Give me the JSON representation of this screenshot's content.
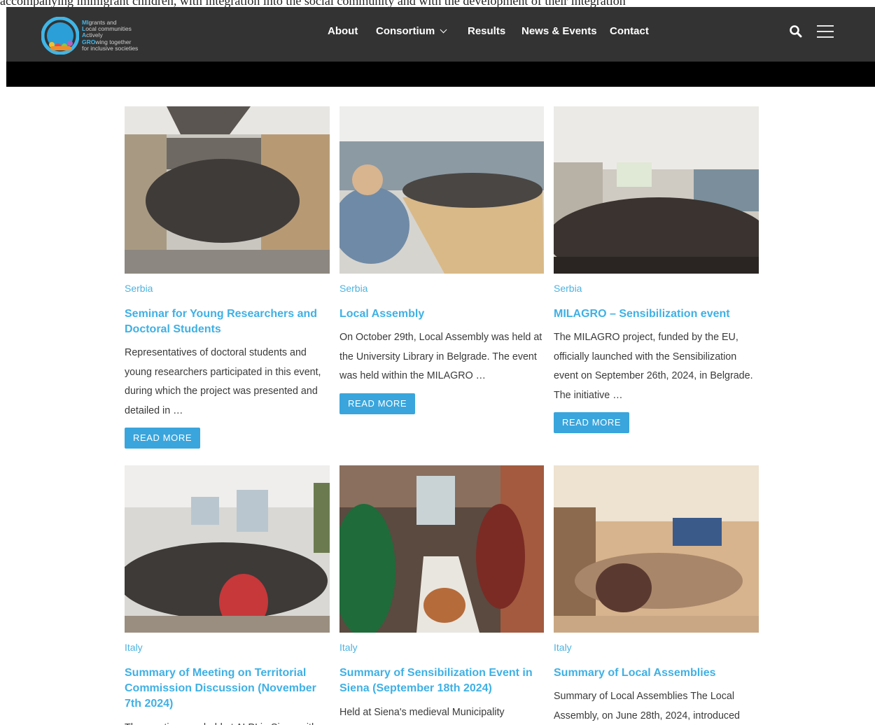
{
  "top_strip_text": "accompanying immigrant children, with integration into the social community and with the development of their integration",
  "logo": {
    "lines": [
      {
        "hl": "MI",
        "rest": "grants and"
      },
      {
        "hl": "L",
        "rest": "ocal communities"
      },
      {
        "hl": "A",
        "rest": "ctively"
      },
      {
        "hl": "GRO",
        "rest": "wing together"
      },
      {
        "hl": "",
        "rest": "for inclusive societies"
      }
    ],
    "badge": "MILAGRO"
  },
  "nav": {
    "about": "About",
    "consortium": "Consortium",
    "results": "Results",
    "news_events": "News & Events",
    "contact": "Contact"
  },
  "icons": {
    "search": "search-icon",
    "menu": "hamburger-menu-icon"
  },
  "colors": {
    "header_bg": "#333333",
    "accent": "#3fb0e4",
    "button": "#3aa5dc"
  },
  "posts": [
    {
      "category": "Serbia",
      "title": "Seminar for Young Researchers and Doctoral Students",
      "excerpt": "Representatives of doctoral students and young researchers participated in this event, during which the project was presented and detailed in …",
      "button": "READ MORE"
    },
    {
      "category": "Serbia",
      "title": "Local Assembly",
      "excerpt": "On October 29th, Local Assembly was held at the University Library in Belgrade. The event was held within the MILAGRO …",
      "button": "READ MORE"
    },
    {
      "category": "Serbia",
      "title": "MILAGRO – Sensibilization event",
      "excerpt": "The MILAGRO project, funded by the EU, officially launched with the Sensibilization event on September 26th, 2024, in Belgrade. The initiative …",
      "button": "READ MORE"
    },
    {
      "category": "Italy",
      "title": "Summary of Meeting on Territorial Commission Discussion (November 7th 2024)",
      "excerpt": "The meeting was held at ALPI in Siena with"
    },
    {
      "category": "Italy",
      "title": "Summary of Sensibilization Event in Siena (September 18th 2024)",
      "excerpt": "Held at Siena's medieval Municipality"
    },
    {
      "category": "Italy",
      "title": "Summary of Local Assemblies",
      "excerpt": "Summary of Local Assemblies The Local Assembly, on June 28th, 2024, introduced"
    }
  ]
}
